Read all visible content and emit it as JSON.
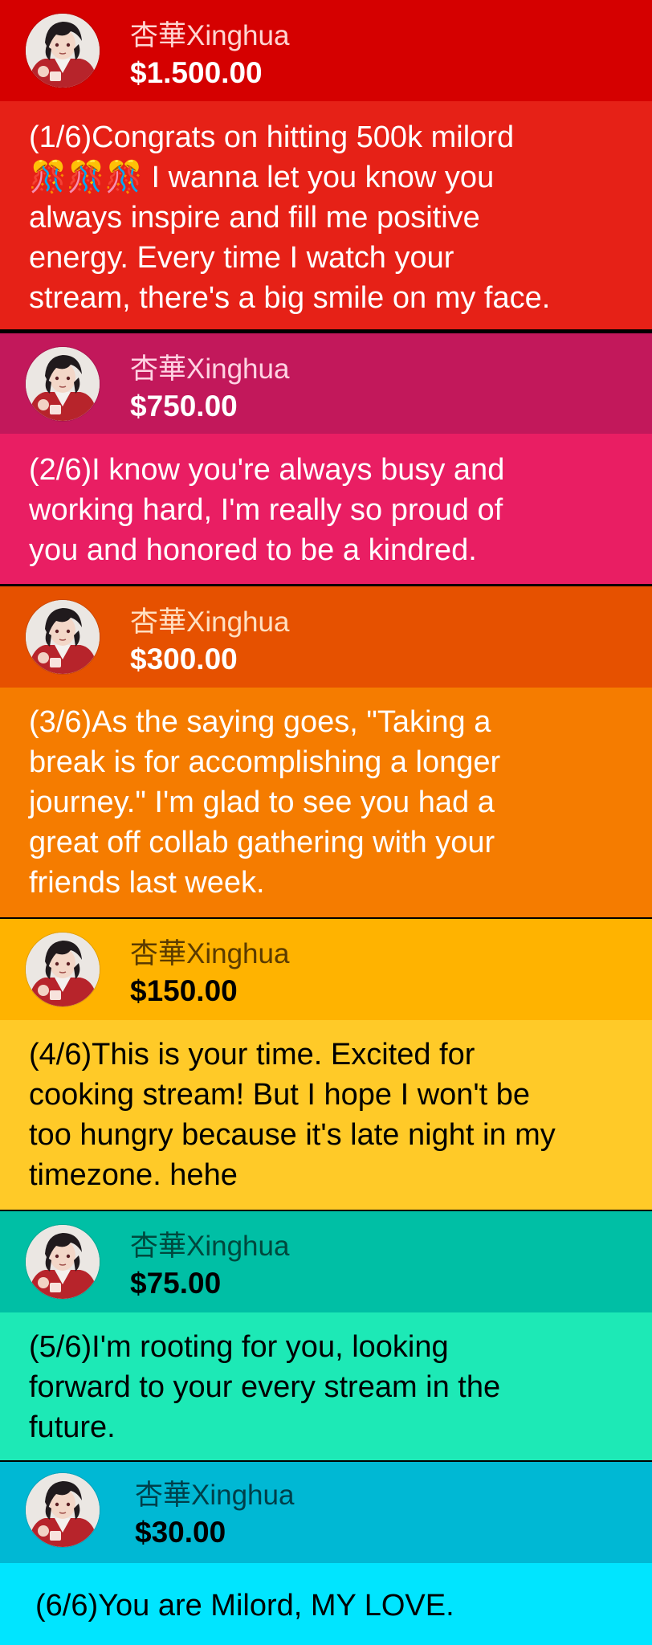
{
  "superchats": [
    {
      "name": "杏華Xinghua",
      "amount": "$1.500.00",
      "message": "(1/6)Congrats on hitting 500k milord\n🎊🎊🎊 I wanna let you know you\nalways inspire and fill me positive\nenergy. Every time I watch your\nstream, there's a big smile on my face.",
      "colors": {
        "header": "#d50000",
        "body": "#e62117",
        "name": "#ffd6d2",
        "amount": "#ffffff",
        "message": "#ffffff"
      }
    },
    {
      "name": "杏華Xinghua",
      "amount": "$750.00",
      "message": "(2/6)I know you're always busy and\nworking hard, I'm really so proud of\nyou and honored to be a kindred.",
      "colors": {
        "header": "#c2185b",
        "body": "#e91e63",
        "name": "#ffd3e3",
        "amount": "#ffffff",
        "message": "#ffffff"
      }
    },
    {
      "name": "杏華Xinghua",
      "amount": "$300.00",
      "message": "(3/6)As the saying goes, \"Taking a\nbreak is for accomplishing a longer\njourney.\" I'm glad to see you had a\ngreat off collab gathering with your\nfriends last week.",
      "colors": {
        "header": "#e65100",
        "body": "#f57c00",
        "name": "#ffe0c2",
        "amount": "#ffffff",
        "message": "#ffffff"
      }
    },
    {
      "name": "杏華Xinghua",
      "amount": "$150.00",
      "message": "(4/6)This is your time. Excited for\ncooking stream! But I hope I won't be\ntoo hungry because it's late night in my\ntimezone. hehe",
      "colors": {
        "header": "#ffb300",
        "body": "#ffca28",
        "name": "#5b3b00",
        "amount": "#000000",
        "message": "#000000"
      }
    },
    {
      "name": "杏華Xinghua",
      "amount": "$75.00",
      "message": "(5/6)I'm rooting for you, looking\nforward to your every stream in the\nfuture.",
      "colors": {
        "header": "#00bfa5",
        "body": "#1de9b6",
        "name": "#00483d",
        "amount": "#000000",
        "message": "#000000"
      }
    },
    {
      "name": "杏華Xinghua",
      "amount": "$30.00",
      "message": "(6/6)You are Milord, MY LOVE.",
      "colors": {
        "header": "#00b8d4",
        "body": "#00e5ff",
        "name": "#003f4a",
        "amount": "#000000",
        "message": "#000000"
      }
    }
  ]
}
